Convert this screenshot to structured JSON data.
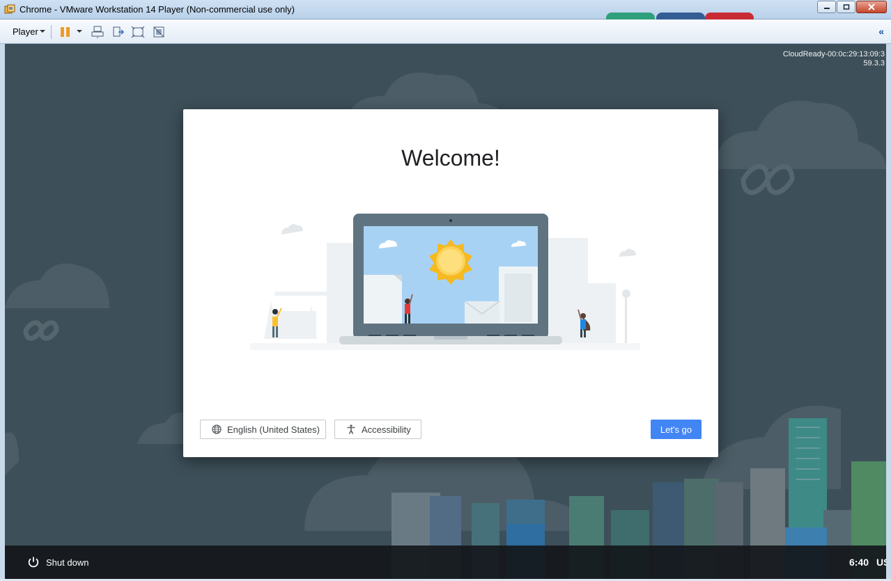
{
  "window": {
    "title": "Chrome - VMware Workstation 14 Player (Non-commercial use only)"
  },
  "toolbar": {
    "player_label": "Player",
    "icons": [
      "pause-icon",
      "send-ctrl-alt-del-icon",
      "removable-devices-icon",
      "fit-guest-icon",
      "unity-icon"
    ],
    "collapse_glyph": "«"
  },
  "guest": {
    "build_info_line1": "CloudReady-00:0c:29:13:09:3",
    "build_info_line2": "59.3.3",
    "welcome_title": "Welcome!",
    "language_button": "English (United States)",
    "accessibility_button": "Accessibility",
    "lets_go_button": "Let's go",
    "shutdown_label": "Shut down",
    "clock": "6:40",
    "ime": "US"
  },
  "colors": {
    "accent": "#4285f4",
    "background": "#3d4f59",
    "shelf": "#14181c"
  }
}
